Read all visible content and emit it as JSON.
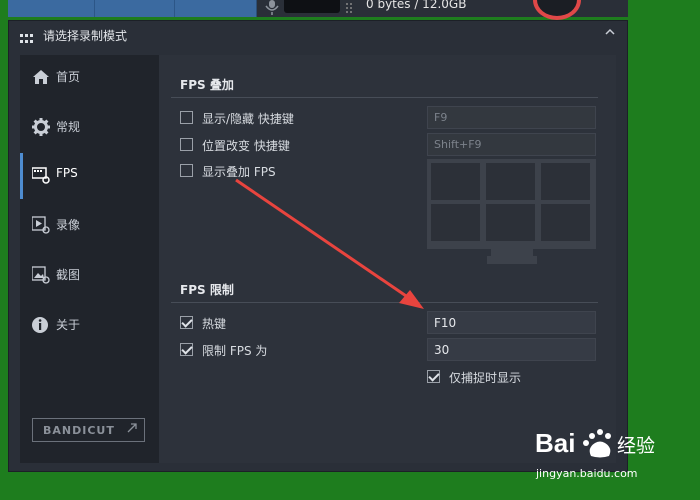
{
  "topbar": {
    "storage_text": "0 bytes / 12.0GB"
  },
  "dialog": {
    "title": "请选择录制模式"
  },
  "sidebar": {
    "items": [
      {
        "label": "首页",
        "icon": "home-icon"
      },
      {
        "label": "常规",
        "icon": "gear-icon"
      },
      {
        "label": "FPS",
        "icon": "fps-icon"
      },
      {
        "label": "录像",
        "icon": "video-icon"
      },
      {
        "label": "截图",
        "icon": "screenshot-icon"
      },
      {
        "label": "关于",
        "icon": "info-icon"
      }
    ],
    "active_index": 2,
    "brand": "BANDICUT"
  },
  "fps_overlay": {
    "heading": "FPS 叠加",
    "options": [
      {
        "label": "显示/隐藏 快捷键",
        "checked": false,
        "hotkey": "F9"
      },
      {
        "label": "位置改变 快捷键",
        "checked": false,
        "hotkey": "Shift+F9"
      },
      {
        "label": "显示叠加 FPS",
        "checked": false
      }
    ]
  },
  "fps_limit": {
    "heading": "FPS 限制",
    "hotkey_label": "热键",
    "hotkey_checked": true,
    "hotkey_value": "F10",
    "limit_label": "限制 FPS 为",
    "limit_checked": true,
    "limit_value": "30",
    "capture_only_label": "仅捕捉时显示",
    "capture_only_checked": true
  },
  "watermark": {
    "brand": "Bai",
    "suffix": "经验",
    "url": "jingyan.baidu.com"
  },
  "colors": {
    "accent": "#4e8cd0",
    "arrow": "#e8443e",
    "desktop": "#1e7d1e"
  }
}
